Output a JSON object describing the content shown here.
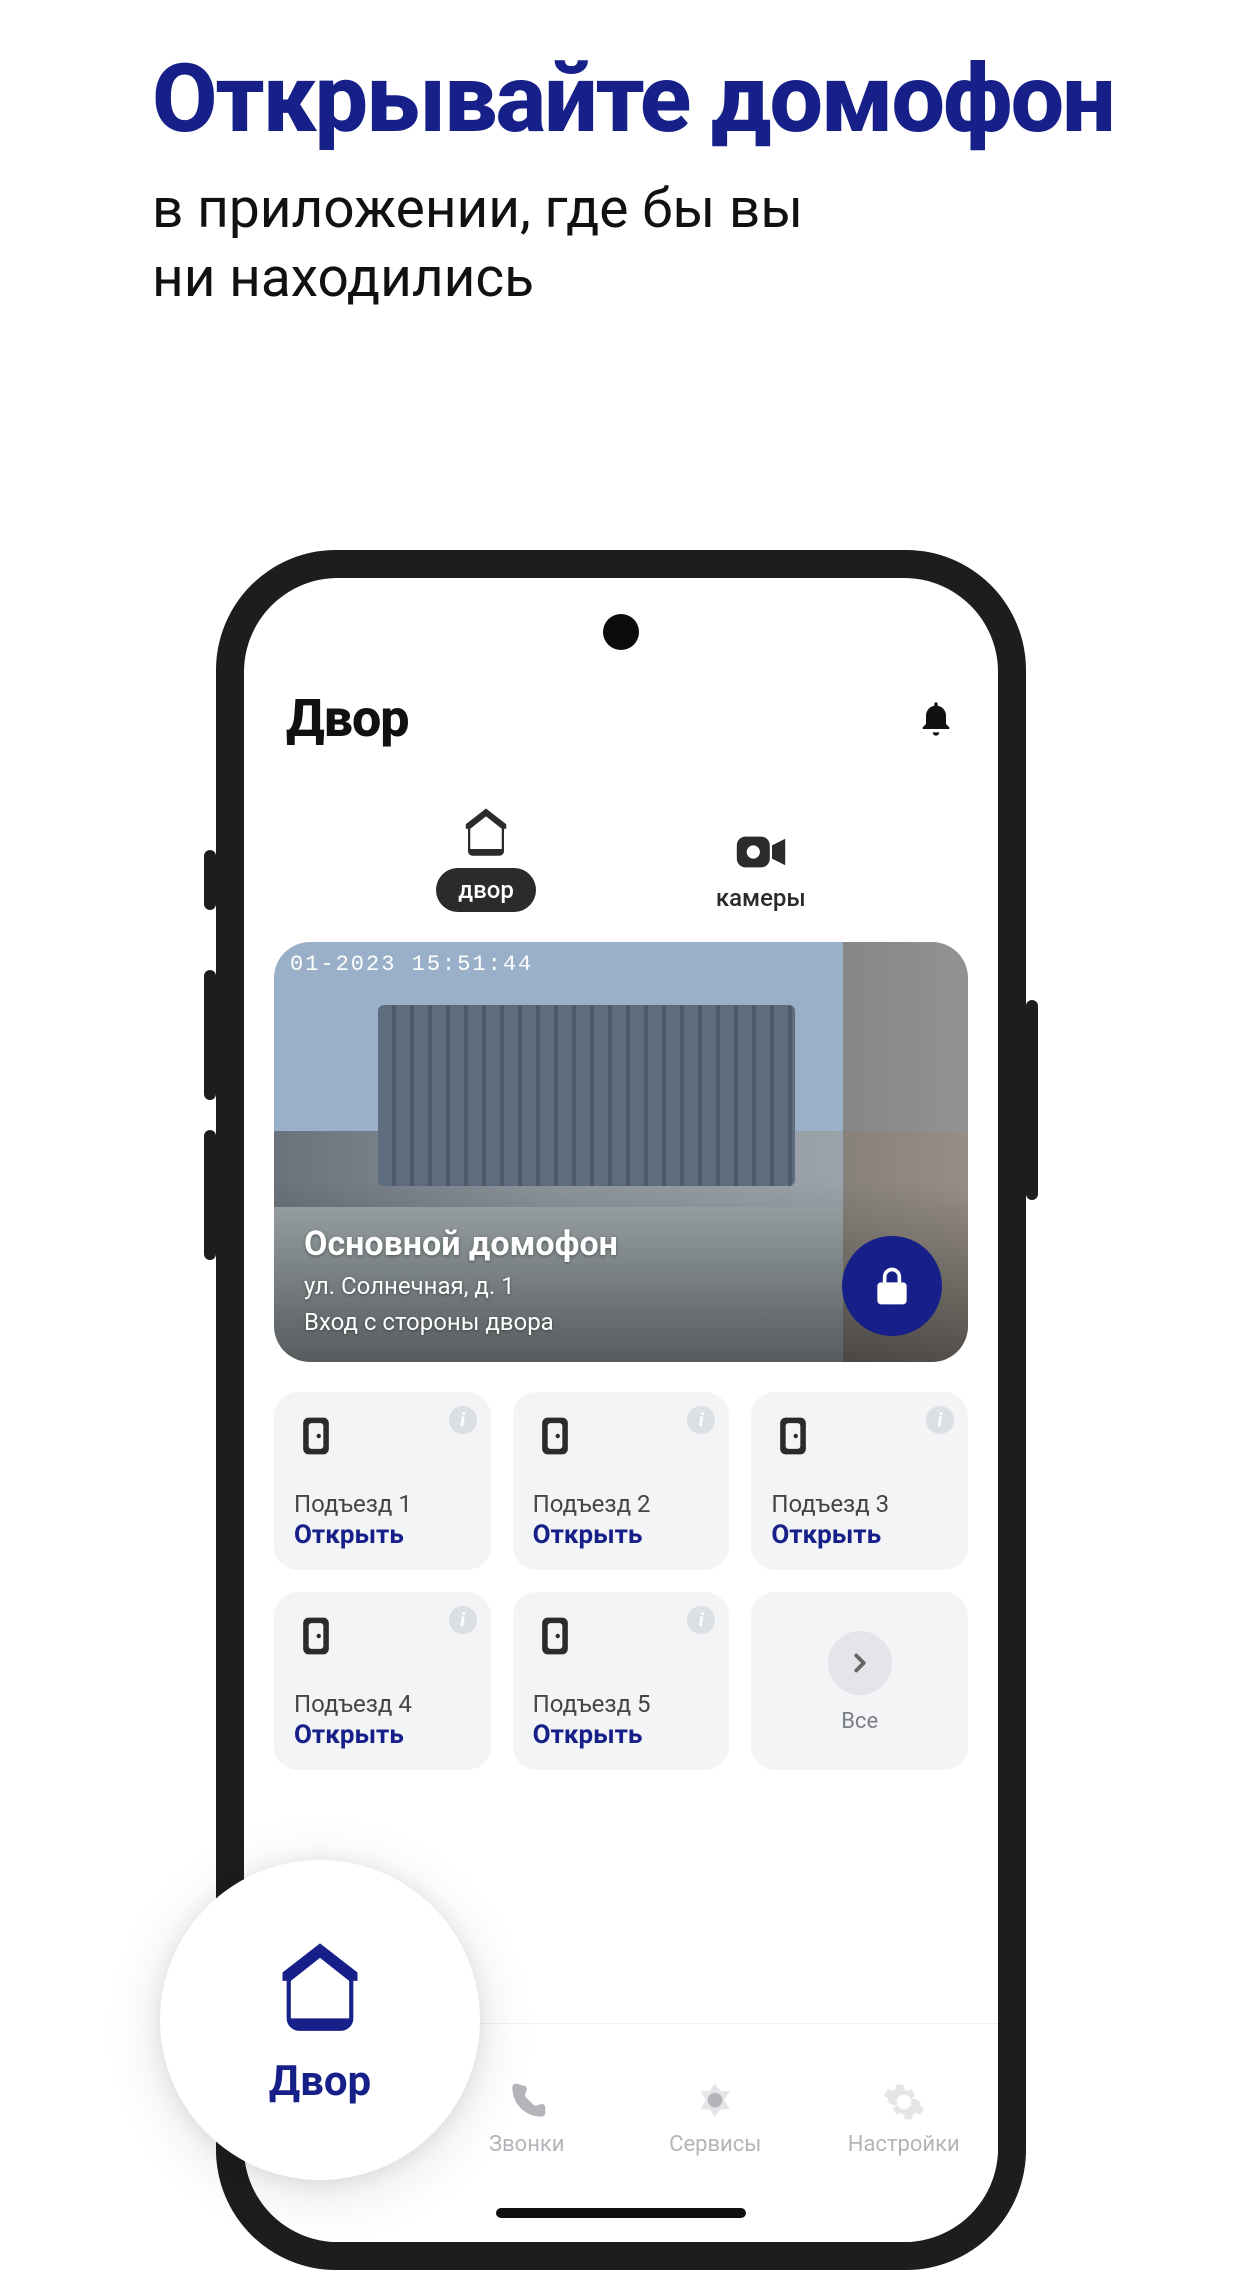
{
  "promo": {
    "title": "Открывайте домофон",
    "subtitle_line1": "в приложении, где бы вы",
    "subtitle_line2": "ни находились"
  },
  "colors": {
    "accent": "#172089",
    "iconDark": "#2b2b2b",
    "muted": "#b3b5ba"
  },
  "app": {
    "title": "Двор",
    "segments": {
      "yard": "двор",
      "cameras": "камеры"
    },
    "camera_preview": {
      "timestamp": "01-2023  15:51:44",
      "title": "Основной домофон",
      "address": "ул. Солнечная, д. 1",
      "location": "Вход с стороны двора"
    },
    "doors": [
      {
        "name": "Подъезд 1",
        "action": "Открыть"
      },
      {
        "name": "Подъезд 2",
        "action": "Открыть"
      },
      {
        "name": "Подъезд 3",
        "action": "Открыть"
      },
      {
        "name": "Подъезд 4",
        "action": "Открыть"
      },
      {
        "name": "Подъезд 5",
        "action": "Открыть"
      }
    ],
    "all_label": "Все",
    "tabs": {
      "yard": "Двор",
      "calls": "Звонки",
      "services": "Сервисы",
      "settings": "Настройки"
    }
  }
}
